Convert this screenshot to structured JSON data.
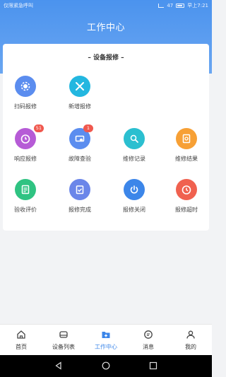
{
  "status_bar": {
    "left_text": "仅限紧急呼叫",
    "time": "早上7:21",
    "battery": "47"
  },
  "header": {
    "title": "工作中心"
  },
  "section": {
    "title": "– 设备报修 –"
  },
  "items": [
    {
      "label": "扫码报修",
      "icon": "qr-scan-icon",
      "color": "#5b8def"
    },
    {
      "label": "新增报修",
      "icon": "tools-icon",
      "color": "#23b7e0"
    },
    {
      "label": "响应报修",
      "icon": "timer-icon",
      "color": "#b65bd6",
      "badge": "51"
    },
    {
      "label": "故障查验",
      "icon": "inspect-icon",
      "color": "#5b8def",
      "badge": "1"
    },
    {
      "label": "维修记录",
      "icon": "record-icon",
      "color": "#2bbfd0"
    },
    {
      "label": "维修结果",
      "icon": "result-icon",
      "color": "#f7a035"
    },
    {
      "label": "验收评价",
      "icon": "evaluate-icon",
      "color": "#2fc382"
    },
    {
      "label": "报修完成",
      "icon": "complete-icon",
      "color": "#6b86e9"
    },
    {
      "label": "报修关闭",
      "icon": "power-icon",
      "color": "#3c86e9"
    },
    {
      "label": "报修超时",
      "icon": "overtime-icon",
      "color": "#f0614f"
    }
  ],
  "bottom_nav": [
    {
      "label": "首页",
      "icon": "home-icon"
    },
    {
      "label": "设备列表",
      "icon": "device-list-icon"
    },
    {
      "label": "工作中心",
      "icon": "work-center-icon",
      "active": true
    },
    {
      "label": "消息",
      "icon": "message-icon"
    },
    {
      "label": "我的",
      "icon": "profile-icon"
    }
  ]
}
